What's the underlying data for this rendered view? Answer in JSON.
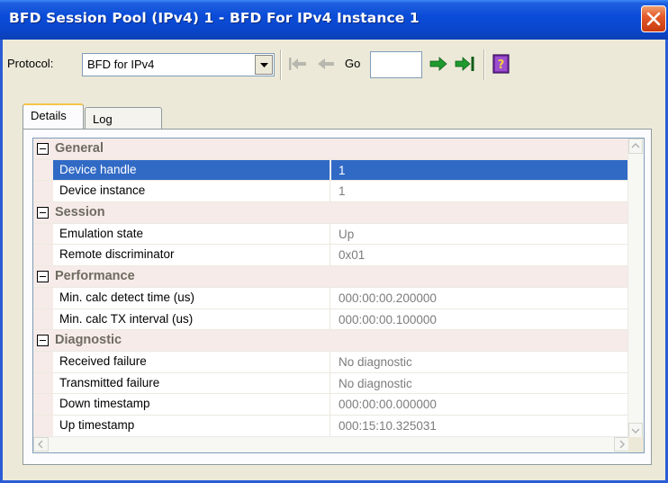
{
  "window": {
    "title": "BFD Session Pool (IPv4) 1 - BFD For IPv4 Instance 1"
  },
  "toolbar": {
    "protocol_label": "Protocol:",
    "protocol_value": "BFD for IPv4",
    "go_label": "Go",
    "go_value": ""
  },
  "tabs": [
    {
      "label": "Details",
      "active": true
    },
    {
      "label": "Log",
      "active": false
    }
  ],
  "grid": {
    "categories": [
      {
        "name": "General",
        "properties": [
          {
            "name": "Device handle",
            "value": "1",
            "selected": true
          },
          {
            "name": "Device instance",
            "value": "1"
          }
        ]
      },
      {
        "name": "Session",
        "properties": [
          {
            "name": "Emulation state",
            "value": "Up"
          },
          {
            "name": "Remote discriminator",
            "value": "0x01"
          }
        ]
      },
      {
        "name": "Performance",
        "properties": [
          {
            "name": "Min. calc detect time (us)",
            "value": "000:00:00.200000"
          },
          {
            "name": "Min. calc TX interval (us)",
            "value": "000:00:00.100000"
          }
        ]
      },
      {
        "name": "Diagnostic",
        "properties": [
          {
            "name": "Received failure",
            "value": "No diagnostic"
          },
          {
            "name": "Transmitted failure",
            "value": "No diagnostic"
          },
          {
            "name": "Down timestamp",
            "value": "000:00:00.000000"
          },
          {
            "name": "Up timestamp",
            "value": "000:15:10.325031"
          }
        ]
      }
    ]
  },
  "colors": {
    "title_bar": "#0a4cd8",
    "selection": "#316ac5",
    "category_bg": "#f6ebe8",
    "value_text": "#7c7c7c"
  },
  "icons": {
    "close": "close-icon",
    "first": "first-record-icon",
    "previous": "previous-record-icon",
    "next": "next-record-icon",
    "last": "last-record-icon",
    "help": "help-book-icon"
  }
}
